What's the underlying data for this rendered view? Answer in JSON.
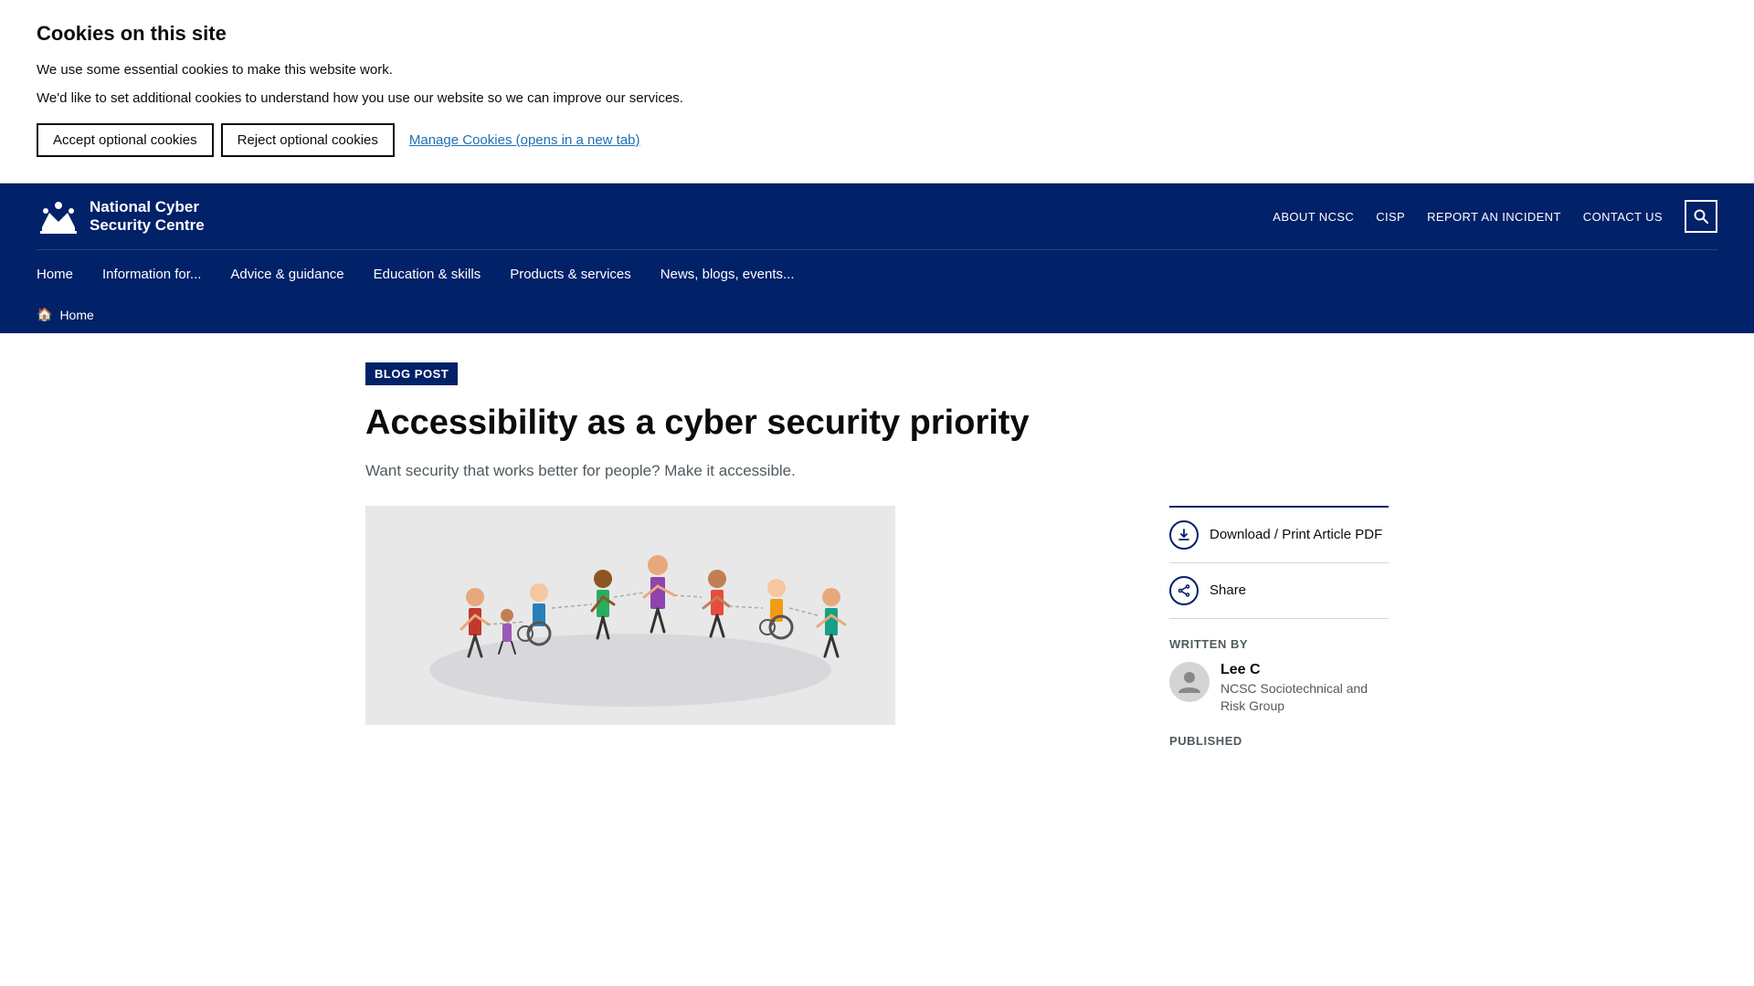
{
  "cookie_banner": {
    "title": "Cookies on this site",
    "text1": "We use some essential cookies to make this website work.",
    "text2": "We'd like to set additional cookies to understand how you use our website so we can improve our services.",
    "accept_label": "Accept optional cookies",
    "reject_label": "Reject optional cookies",
    "manage_label": "Manage Cookies (opens in a new tab)"
  },
  "header": {
    "logo_line1": "National Cyber",
    "logo_line2": "Security Centre",
    "links": [
      {
        "label": "ABOUT NCSC",
        "id": "about-ncsc"
      },
      {
        "label": "CISP",
        "id": "cisp"
      },
      {
        "label": "REPORT AN INCIDENT",
        "id": "report-incident"
      },
      {
        "label": "CONTACT US",
        "id": "contact-us"
      }
    ]
  },
  "main_nav": [
    {
      "label": "Home",
      "id": "home"
    },
    {
      "label": "Information for...",
      "id": "information-for"
    },
    {
      "label": "Advice & guidance",
      "id": "advice-guidance"
    },
    {
      "label": "Education & skills",
      "id": "education-skills"
    },
    {
      "label": "Products & services",
      "id": "products-services"
    },
    {
      "label": "News, blogs, events...",
      "id": "news-blogs-events"
    }
  ],
  "breadcrumb": {
    "home_label": "Home"
  },
  "article": {
    "tag": "BLOG POST",
    "title": "Accessibility as a cyber security priority",
    "subtitle": "Want security that works better for people? Make it accessible.",
    "download_label": "Download / Print Article PDF",
    "share_label": "Share",
    "written_by_label": "WRITTEN BY",
    "author_name": "Lee C",
    "author_org": "NCSC Sociotechnical and Risk Group",
    "published_label": "PUBLISHED"
  }
}
